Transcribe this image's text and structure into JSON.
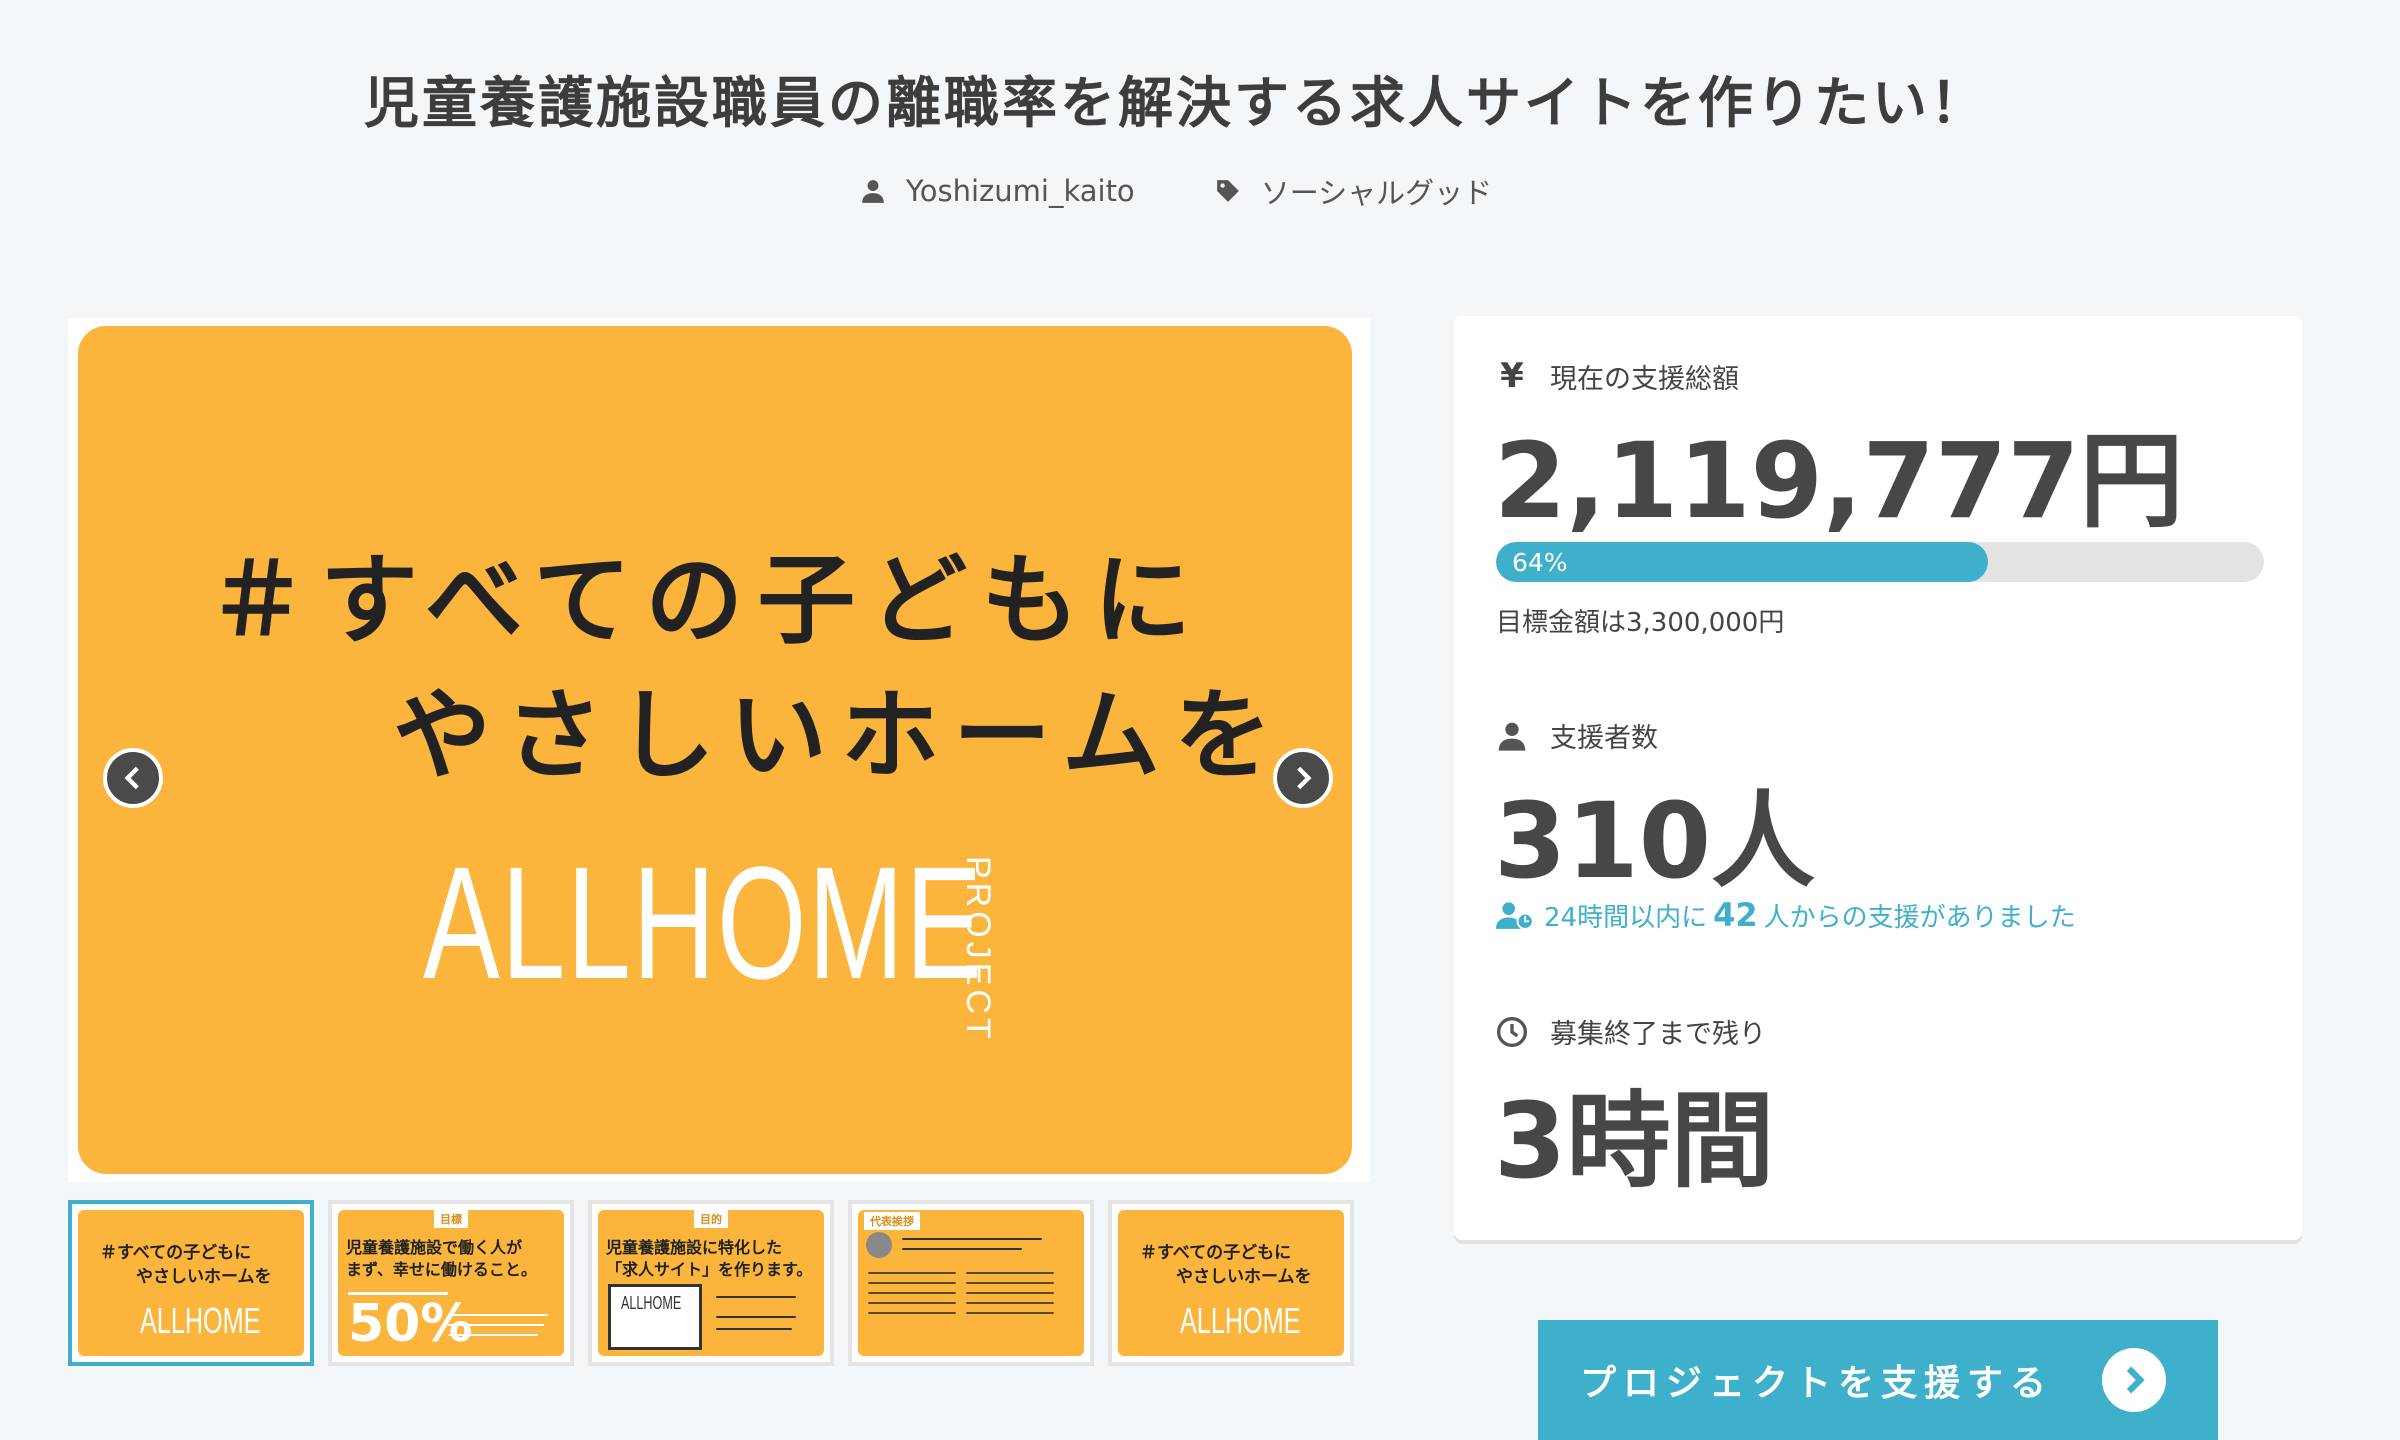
{
  "project": {
    "title": "児童養護施設職員の離職率を解決する求人サイトを作りたい！",
    "author": "Yoshizumi_kaito",
    "category": "ソーシャルグッド"
  },
  "hero": {
    "line1": "＃すべての子どもに",
    "line2": "やさしいホームを",
    "logo": "ALLHOME",
    "logo_sub": "PROJECT"
  },
  "thumbnails": [
    {
      "line1": "＃すべての子どもに",
      "line2": "やさしいホームを",
      "logo": "ALLHOME"
    },
    {
      "tag": "目標",
      "line1": "児童養護施設で働く人が",
      "line2": "まず、幸せに働けること。",
      "big": "50%"
    },
    {
      "tag": "目的",
      "line1": "児童養護施設に特化した",
      "line2": "「求人サイト」を作ります。",
      "logo": "ALLHOME"
    },
    {
      "tag": "代表挨拶"
    },
    {
      "line1": "＃すべての子どもに",
      "line2": "やさしいホームを",
      "logo": "ALLHOME"
    }
  ],
  "stats": {
    "amount_label": "現在の支援総額",
    "amount": "2,119,777円",
    "progress_percent": 64,
    "progress_label": "64%",
    "goal": "目標金額は3,300,000円",
    "supporters_label": "支援者数",
    "supporters": "310人",
    "recent_prefix": "24時間以内に",
    "recent_count": "42",
    "recent_suffix": "人からの支援がありました",
    "remaining_label": "募集終了まで残り",
    "remaining": "3時間"
  },
  "cta": {
    "label": "プロジェクトを支援する"
  },
  "colors": {
    "accent": "#3fb0cc",
    "hero_bg": "#fbb53d"
  }
}
